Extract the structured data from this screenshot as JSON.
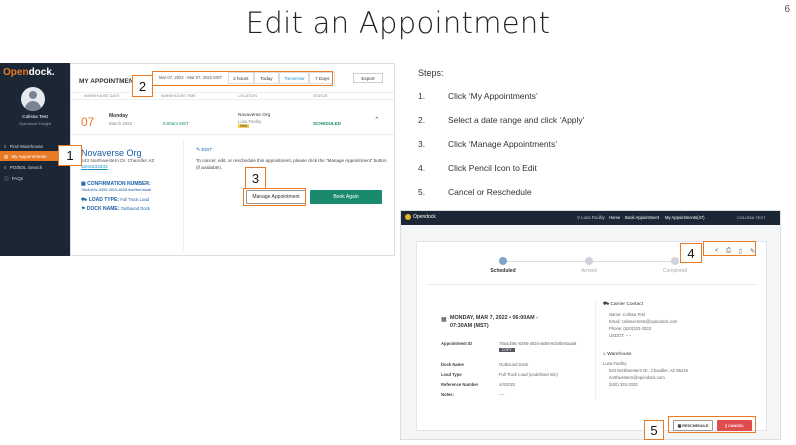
{
  "slide": {
    "title": "Edit an Appointment",
    "page_number": "6"
  },
  "steps": {
    "label": "Steps:",
    "items": [
      {
        "num": "1.",
        "text": "Click ‘My Appointments’"
      },
      {
        "num": "2.",
        "text": "Select a date range and click ‘Apply’"
      },
      {
        "num": "3.",
        "text": "Click ‘Manage Appointments’"
      },
      {
        "num": "4.",
        "text": "Click Pencil Icon to Edit"
      },
      {
        "num": "5.",
        "text": "Cancel or Reschedule"
      }
    ]
  },
  "badges": [
    "1",
    "2",
    "3",
    "4",
    "5"
  ],
  "left_app": {
    "logo_open": "Open",
    "logo_dock": "dock.",
    "user_name": "Colissa Test",
    "user_role": "Opendock Freight",
    "nav": [
      "Find Warehouse",
      "My Appointments",
      "PO/BOL Search",
      "FAQs"
    ],
    "header_title": "MY APPOINTMENTS",
    "date_range": "Mar 07, 2022 - Mar 07, 2022 MST",
    "quick_filters": [
      "2 hours",
      "Today",
      "Tomorrow",
      "7 Days"
    ],
    "export": "Export",
    "columns": [
      "WAREHOUSE DATE",
      "WAREHOUSE TIME",
      "LOCATION",
      "STATUS"
    ],
    "row": {
      "day": "07",
      "weekday": "Monday",
      "month": "March 2022",
      "time": "6:00am MST",
      "org": "Novaverse Org",
      "facility": "Luna Facility",
      "tag": "New",
      "status": "SCHEDULED"
    },
    "detail": {
      "org": "Novaverse Org",
      "address": "543 Northwestern Dr. Chandler AZ",
      "phone": "5203333333",
      "conf_label": "CONFIRMATION NUMBER:",
      "conf_value": "78a4d49c-6395-4815-a608-6cb0be0aaa8",
      "load_label": "LOAD TYPE:",
      "load_value": "Full Truck Load",
      "dock_label": "DOCK NAME:",
      "dock_value": "Outbound Dock",
      "edit_label": "EDIT",
      "edit_text": "To cancel, edit, or reschedule this appointment, please click the “Manage Appointment” button (if available).",
      "manage_btn": "Manage Appointment",
      "book_btn": "Book Again"
    }
  },
  "right_app": {
    "brand": "Opendock",
    "nav": [
      "Luna Facility",
      "Home",
      "Book Appointment",
      "My Appointments(47)",
      "COLISSA TEST"
    ],
    "progress": [
      "Scheduled",
      "Arrived",
      "Completed"
    ],
    "datetime": "MONDAY, MAR 7, 2022 • 06:00AM - 07:30AM (MST)",
    "fields": [
      {
        "label": "Appointment ID",
        "value": "78a4d49c-6395-4815-a608-6cb0be0aaa8"
      },
      {
        "label": "Dock Name",
        "value": "Outbound Dock"
      },
      {
        "label": "Load Type",
        "value": "Full Truck Load (undefined min)"
      },
      {
        "label": "Reference Number",
        "value": "4/4/2022"
      },
      {
        "label": "Notes:",
        "value": "----"
      }
    ],
    "copy": "COPY",
    "carrier_title": "Carrier Contact",
    "carrier_lines": [
      "Name: Colissa Test",
      "Email: colissa+tests@opendock.com",
      "Phone: (520)333-3333",
      "USDOT: ----"
    ],
    "warehouse_title": "Warehouse",
    "warehouse_lines": [
      "Luna Facility",
      "543 Northwestern Dr., Chandler, AZ 85226",
      "northwestern@opendock.com",
      "(520) 333-3333"
    ],
    "reschedule": "RESCHEDULE",
    "cancel": "CANCEL"
  },
  "colors": {
    "accent": "#e97a25",
    "nav_dark": "#1b2734",
    "green": "#1a8a6e",
    "teal": "#0f8f8c",
    "red": "#e24b4b"
  }
}
